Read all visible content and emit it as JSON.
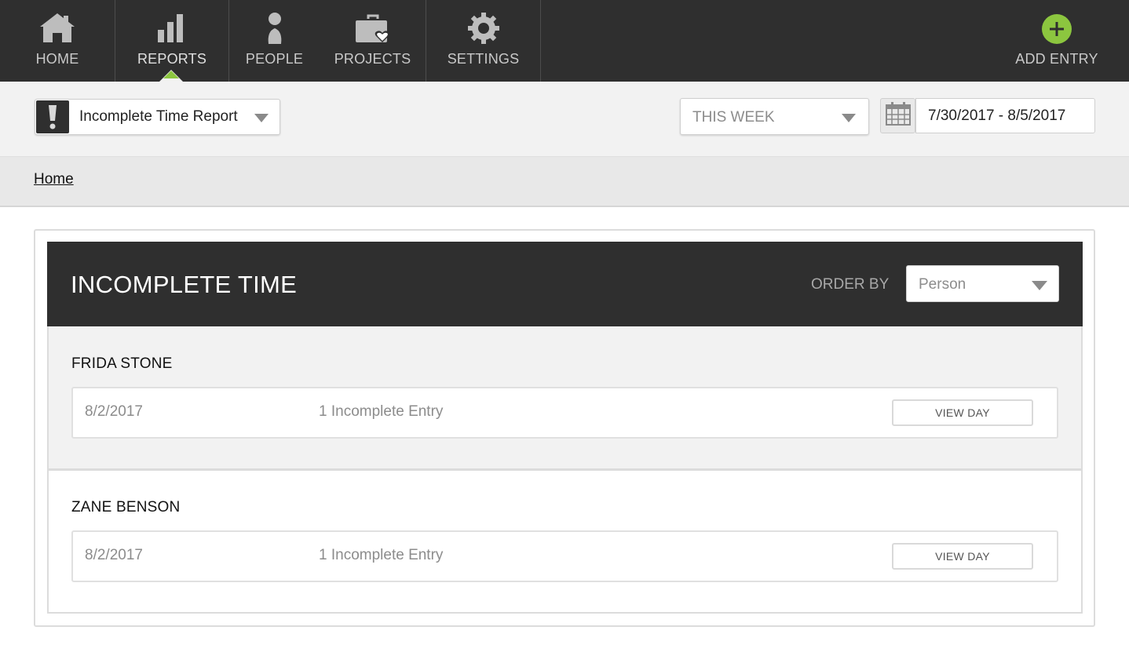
{
  "nav": {
    "items": [
      {
        "label": "HOME",
        "icon": "home-icon"
      },
      {
        "label": "REPORTS",
        "icon": "bar-chart-icon"
      },
      {
        "label": "PEOPLE",
        "icon": "person-icon"
      },
      {
        "label": "PROJECTS",
        "icon": "briefcase-heart-icon"
      },
      {
        "label": "SETTINGS",
        "icon": "gear-icon"
      }
    ],
    "active": "REPORTS",
    "add_entry_label": "ADD ENTRY",
    "add_entry_icon": "plus-circle-icon"
  },
  "toolbar": {
    "report_select": "Incomplete Time Report",
    "report_icon": "exclamation-icon",
    "period_select": "THIS WEEK",
    "calendar_icon": "calendar-icon",
    "date_range": "7/30/2017 - 8/5/2017"
  },
  "breadcrumb": {
    "home": "Home"
  },
  "panel": {
    "title": "INCOMPLETE TIME",
    "order_by_label": "ORDER BY",
    "order_by_value": "Person",
    "groups": [
      {
        "person": "FRIDA STONE",
        "date": "8/2/2017",
        "count": "1 Incomplete Entry",
        "action": "VIEW DAY"
      },
      {
        "person": "ZANE BENSON",
        "date": "8/2/2017",
        "count": "1 Incomplete Entry",
        "action": "VIEW DAY"
      }
    ]
  },
  "colors": {
    "nav_bg": "#2f2f2f",
    "accent_green": "#8cc63f",
    "toolbar_bg": "#f2f2f2",
    "breadcrumb_bg": "#e8e8e8"
  }
}
